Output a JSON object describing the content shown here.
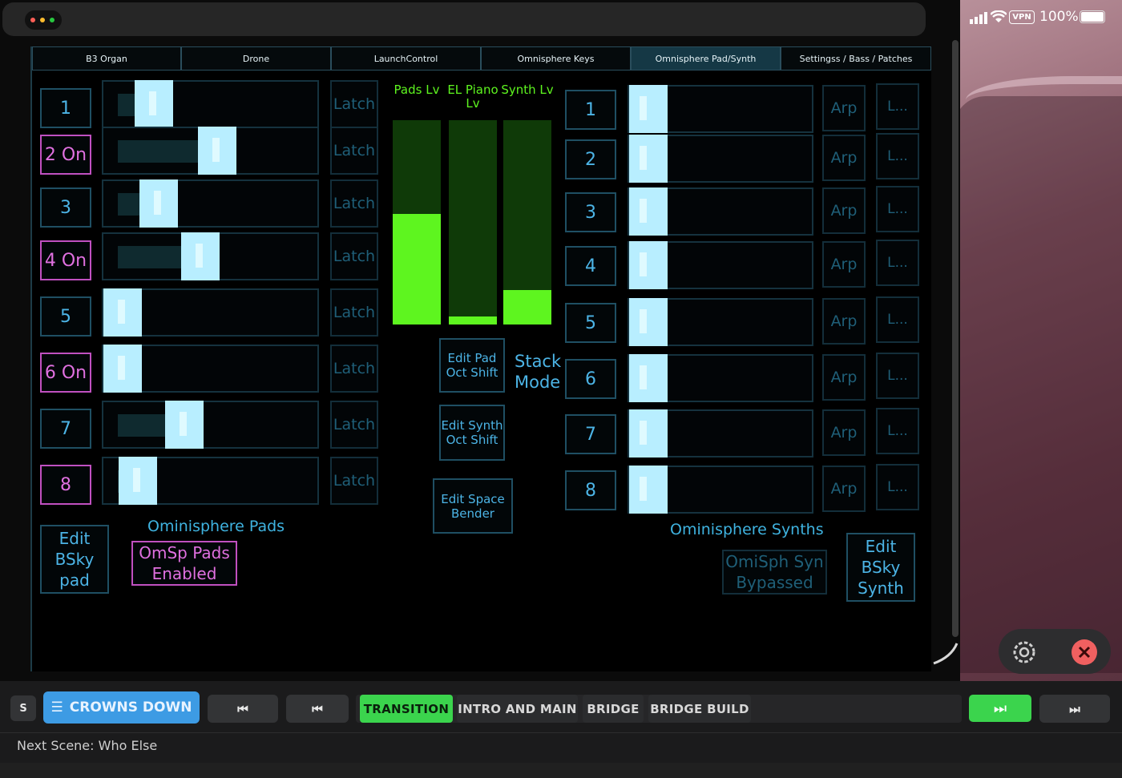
{
  "status_bar": {
    "battery": "100%",
    "vpn": "VPN"
  },
  "tabs": [
    {
      "label": "B3 Organ",
      "active": false
    },
    {
      "label": "Drone",
      "active": false
    },
    {
      "label": "LaunchControl",
      "active": false
    },
    {
      "label": "Omnisphere Keys",
      "active": false
    },
    {
      "label": "Omnisphere Pad/Synth",
      "active": true
    },
    {
      "label": "Settingss / Bass / Patches",
      "active": false
    }
  ],
  "pads": {
    "section_label": "Ominisphere Pads",
    "buttons": [
      "1",
      "2 On",
      "3",
      "4 On",
      "5",
      "6 On",
      "7",
      "8"
    ],
    "button_on": [
      false,
      true,
      false,
      true,
      false,
      true,
      false,
      true
    ],
    "latch_label": "Latch",
    "levels": [
      0.18,
      0.55,
      0.21,
      0.45,
      0.0,
      0.0,
      0.36,
      0.09
    ],
    "edit_button": "Edit BSky pad",
    "toggle": "OmSp Pads Enabled"
  },
  "meters": [
    {
      "label": "Pads Lv",
      "level": 0.54
    },
    {
      "label": "EL Piano Lv",
      "level": 0.04
    },
    {
      "label": "Synth Lv",
      "level": 0.17
    }
  ],
  "center": {
    "edit_pad_oct": "Edit Pad Oct Shift",
    "stack_mode": "Stack Mode",
    "edit_synth_oct": "Edit Synth Oct Shift",
    "edit_space_bender": "Edit Space Bender"
  },
  "synths": {
    "section_label": "Ominisphere Synths",
    "buttons": [
      "1",
      "2",
      "3",
      "4",
      "5",
      "6",
      "7",
      "8"
    ],
    "levels": [
      0,
      0,
      0,
      0,
      0,
      0,
      0,
      0
    ],
    "arp_label": "Arp",
    "l_label": "L...",
    "bypass": "OmiSph Syn Bypassed",
    "edit_button": "Edit BSky Synth"
  },
  "player": {
    "s_label": "S",
    "setlist": "CROWNS DOWN",
    "scenes": [
      "TRANSITION",
      "INTRO AND MAIN",
      "BRIDGE",
      "BRIDGE BUILD"
    ],
    "active_scene": "TRANSITION",
    "next_scene": "Next Scene: Who Else"
  },
  "colors": {
    "accent_green": "#3bd44d",
    "accent_blue": "#3d9be4",
    "on_magenta": "#e070e0",
    "meter_green": "#5ef51f"
  }
}
